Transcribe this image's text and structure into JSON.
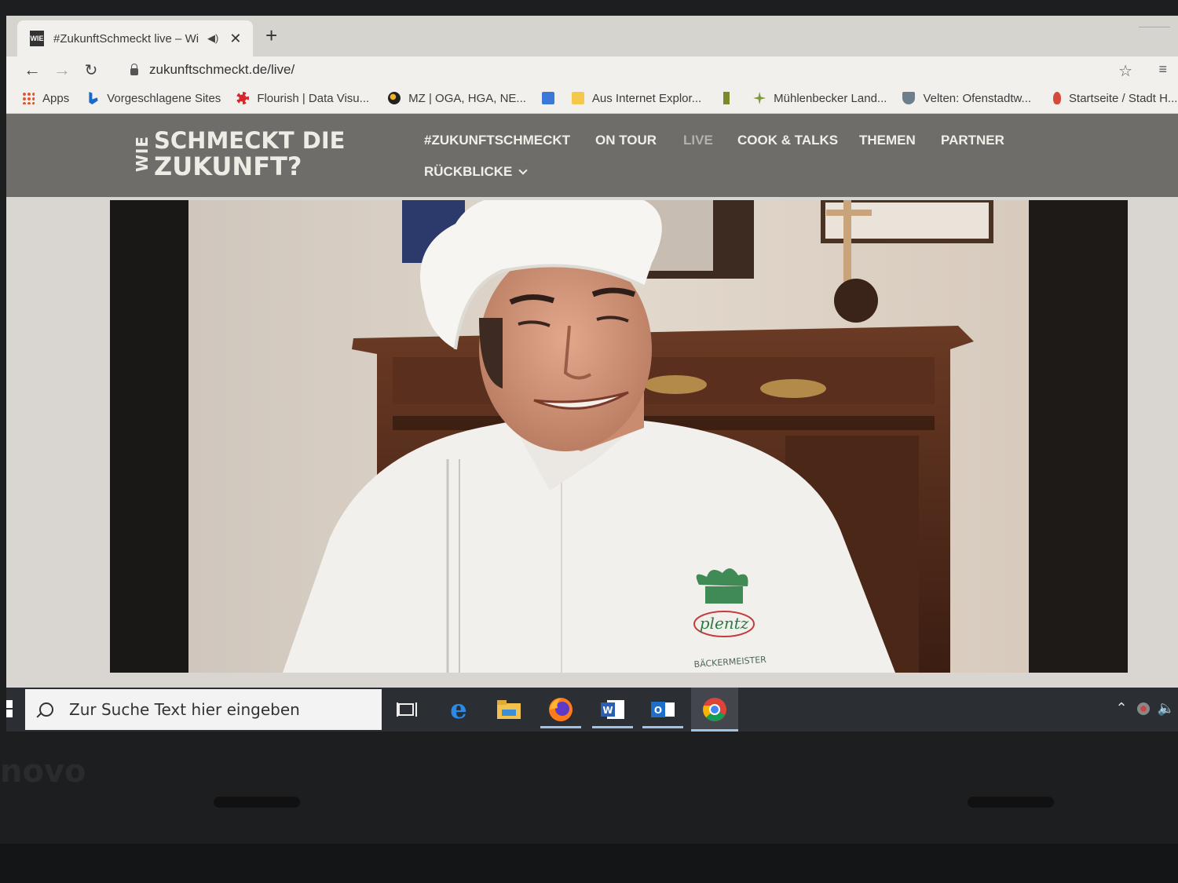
{
  "browser": {
    "tab_title": "#ZukunftSchmeckt live – Wi",
    "favicon_text": "WIE",
    "new_tab": "+",
    "url": "zukunftschmeckt.de/live/"
  },
  "bookmarks": [
    {
      "label": "Apps",
      "icon": "apps-grid-icon"
    },
    {
      "label": "Vorgeschlagene Sites",
      "icon": "bing-icon"
    },
    {
      "label": "Flourish | Data Visu...",
      "icon": "flourish-icon"
    },
    {
      "label": "MZ | OGA, HGA, NE...",
      "icon": "mz-icon"
    },
    {
      "label": "",
      "icon": "doc-icon"
    },
    {
      "label": "Aus Internet Explor...",
      "icon": "folder-icon"
    },
    {
      "label": "",
      "icon": "green-bar-icon"
    },
    {
      "label": "Mühlenbecker Land...",
      "icon": "muehlenbeck-icon"
    },
    {
      "label": "Velten: Ofenstadtw...",
      "icon": "crest-icon"
    },
    {
      "label": "Startseite / Stadt H...",
      "icon": "flame-icon"
    }
  ],
  "site": {
    "logo_side": "WIE",
    "logo_line1": "SCHMECKT DIE",
    "logo_line2": "ZUKUNFT?",
    "nav": [
      {
        "label": "#ZUKUNFTSCHMECKT",
        "active": false
      },
      {
        "label": "ON TOUR",
        "active": false
      },
      {
        "label": "LIVE",
        "active": true
      },
      {
        "label": "COOK & TALKS",
        "active": false
      },
      {
        "label": "THEMEN",
        "active": false
      },
      {
        "label": "PARTNER",
        "active": false
      },
      {
        "label": "RÜCKBLICKE",
        "active": false,
        "dropdown": true
      }
    ]
  },
  "video": {
    "logo_text": "plentz",
    "logo_sub": "BÄCKERMEISTER"
  },
  "taskbar": {
    "search_placeholder": "Zur Suche Text hier eingeben",
    "apps": [
      "task-view-icon",
      "edge-icon",
      "file-explorer-icon",
      "firefox-icon",
      "word-icon",
      "outlook-icon",
      "chrome-icon"
    ]
  },
  "laptop": {
    "brand": "novo"
  },
  "colors": {
    "site_header": "#6f6d69",
    "nav_active": "#b4b1ab",
    "taskbar": "#2b2e33"
  }
}
